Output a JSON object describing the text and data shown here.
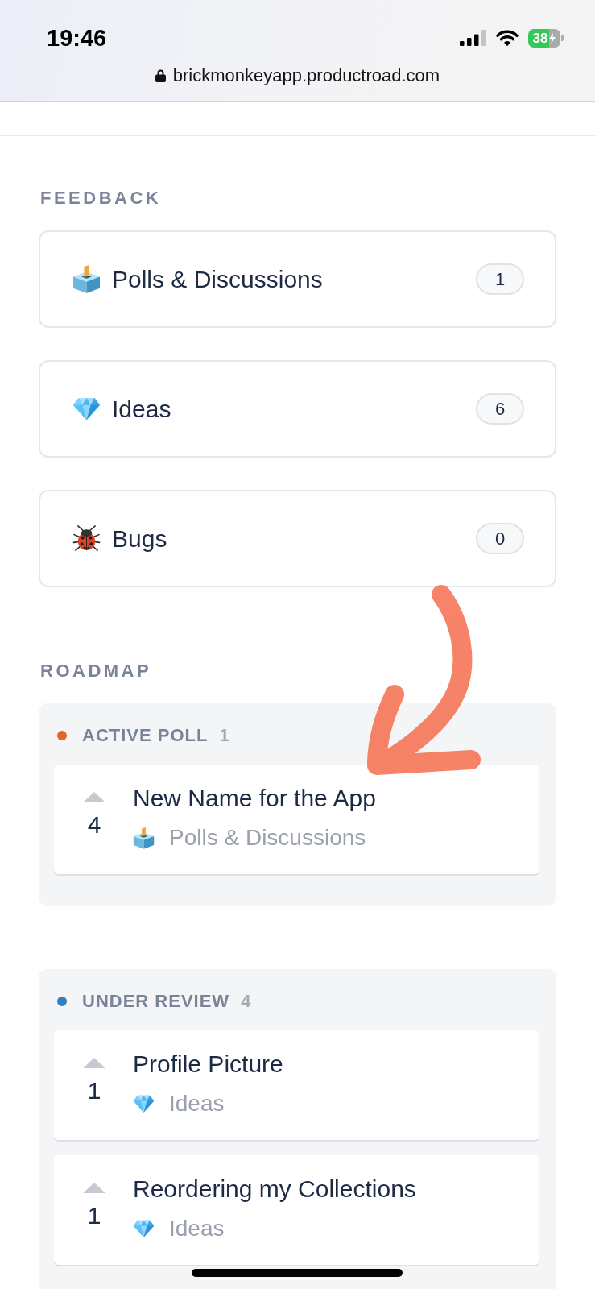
{
  "status_bar": {
    "time": "19:46",
    "battery": "38"
  },
  "address_bar": {
    "url": "brickmonkeyapp.productroad.com"
  },
  "feedback": {
    "heading": "FEEDBACK",
    "boards": [
      {
        "kind": "poll",
        "label": "Polls & Discussions",
        "count": "1"
      },
      {
        "kind": "idea",
        "label": "Ideas",
        "count": "6"
      },
      {
        "kind": "bug",
        "label": "Bugs",
        "count": "0"
      }
    ]
  },
  "roadmap": {
    "heading": "ROADMAP",
    "groups": [
      {
        "title": "ACTIVE POLL",
        "count": "1",
        "color": "#e8622c",
        "cards": [
          {
            "votes": "4",
            "title": "New Name for the App",
            "category": {
              "kind": "poll",
              "label": "Polls & Discussions"
            }
          }
        ]
      },
      {
        "title": "UNDER REVIEW",
        "count": "4",
        "color": "#2f7fc1",
        "cards": [
          {
            "votes": "1",
            "title": "Profile Picture",
            "category": {
              "kind": "idea",
              "label": "Ideas"
            }
          },
          {
            "votes": "1",
            "title": "Reordering my Collections",
            "category": {
              "kind": "idea",
              "label": "Ideas"
            }
          }
        ]
      }
    ]
  }
}
